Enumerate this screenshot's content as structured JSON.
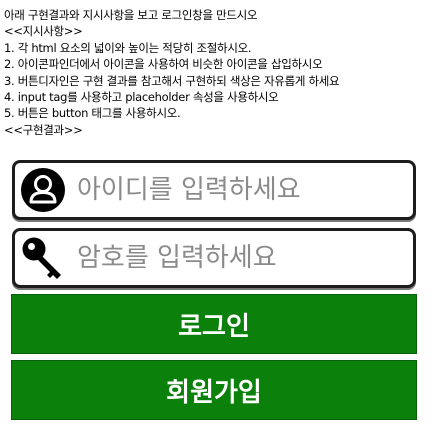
{
  "instructions": {
    "lines": [
      "아래 구현결과와 지시사항을 보고 로그인창을 만드시오",
      "<<지시사항>>",
      "1. 각 html 요소의 넓이와 높이는 적당히 조절하시오.",
      "2. 아이콘파인더에서 아이콘을 사용하여 비슷한 아이콘을 삽입하시오",
      "3. 버튼디자인은 구현 결과를 참고해서 구현하되 색상은 자유롭게 하세요",
      "4. input tag를 사용하고 placeholder 속성을 사용하시오",
      "5. 버튼은 button 태그를 사용하시오.",
      "<<구현결과>>"
    ]
  },
  "login_form": {
    "id_field": {
      "icon": "user-icon",
      "placeholder": "아이디를 입력하세요",
      "value": ""
    },
    "password_field": {
      "icon": "key-icon",
      "placeholder": "암호를 입력하세요",
      "value": ""
    },
    "login_button": {
      "label": "로그인"
    },
    "join_button": {
      "label": "회원가입"
    }
  },
  "colors": {
    "button_background": "#0b800b",
    "button_text": "#ffffff",
    "field_border": "#1c1c1c"
  }
}
